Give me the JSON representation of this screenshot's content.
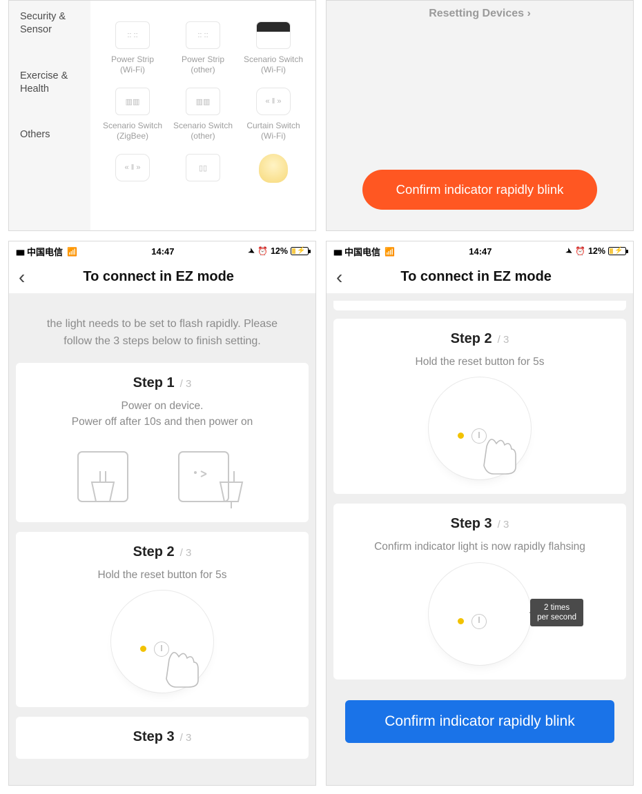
{
  "panelA": {
    "sidebar": [
      "Security\n& Sensor",
      "Exercise\n& Health",
      "Others"
    ],
    "devices": [
      {
        "label": "Power Strip\n(Wi-Fi)"
      },
      {
        "label": "Power Strip\n(other)"
      },
      {
        "label": "Scenario Switch\n(Wi-Fi)"
      },
      {
        "label": "Scenario Switch\n(ZigBee)"
      },
      {
        "label": "Scenario Switch\n(other)"
      },
      {
        "label": "Curtain Switch\n(Wi-Fi)"
      },
      {
        "label": ""
      },
      {
        "label": ""
      },
      {
        "label": ""
      }
    ]
  },
  "panelB": {
    "reset_link": "Resetting Devices ›",
    "confirm_btn": "Confirm indicator rapidly blink"
  },
  "status": {
    "carrier": "中国电信",
    "time": "14:47",
    "battery_pct": "12%"
  },
  "nav": {
    "title": "To connect in EZ mode"
  },
  "panelC": {
    "intro": "the light needs to be set to flash rapidly. Please follow the 3 steps below to finish setting.",
    "steps": [
      {
        "title": "Step 1",
        "of": "/ 3",
        "desc": "Power on device.\nPower off after 10s and then power on"
      },
      {
        "title": "Step 2",
        "of": "/ 3",
        "desc": "Hold the reset button for 5s"
      },
      {
        "title": "Step 3",
        "of": "/ 3",
        "desc": ""
      }
    ]
  },
  "panelD": {
    "steps": [
      {
        "title": "Step 2",
        "of": "/ 3",
        "desc": "Hold the reset button for 5s"
      },
      {
        "title": "Step 3",
        "of": "/ 3",
        "desc": "Confirm indicator light is now rapidly flahsing"
      }
    ],
    "tooltip": "2 times\nper second",
    "confirm_btn": "Confirm indicator rapidly blink"
  }
}
